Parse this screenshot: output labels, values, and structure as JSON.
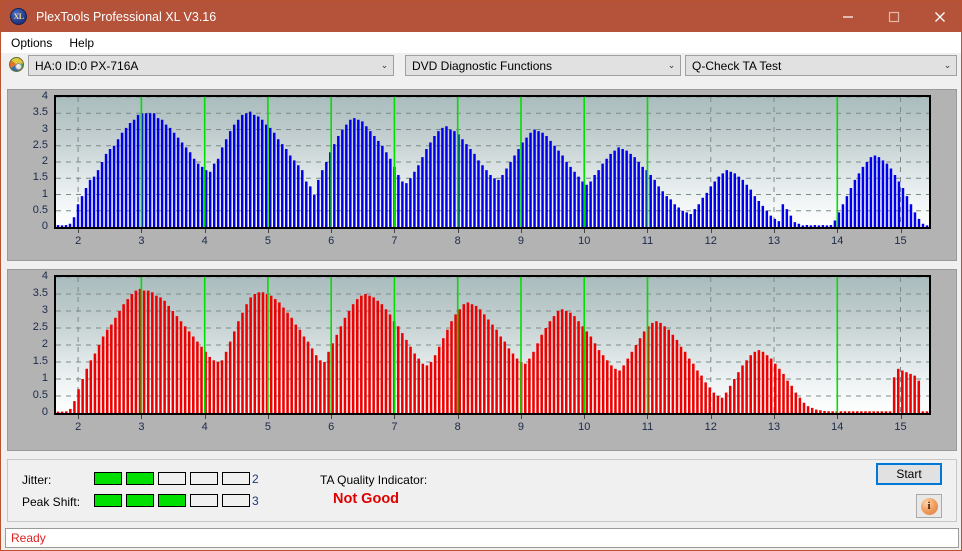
{
  "window": {
    "title": "PlexTools Professional XL V3.16",
    "app_icon": "xl-logo-icon",
    "minimize": "minimize-icon",
    "maximize": "maximize-icon",
    "close": "close-icon"
  },
  "menu": {
    "items": [
      {
        "label": "Options"
      },
      {
        "label": "Help"
      }
    ]
  },
  "toolbar": {
    "drive_icon": "disc-icon",
    "drive_combo": "HA:0 ID:0  PX-716A",
    "function_combo": "DVD Diagnostic Functions",
    "test_combo": "Q-Check TA Test",
    "arrow": "⌄"
  },
  "results": {
    "jitter_label": "Jitter:",
    "jitter_value": "2",
    "jitter_segments": 5,
    "jitter_filled": 2,
    "peak_shift_label": "Peak Shift:",
    "peak_shift_value": "3",
    "peak_shift_segments": 5,
    "peak_shift_filled": 3,
    "tqi_label": "TA Quality Indicator:",
    "tqi_value": "Not Good",
    "tqi_color": "#e00000",
    "start_label": "Start",
    "info_icon": "info-icon",
    "info_glyph": "i"
  },
  "statusbar": {
    "text": "Ready"
  },
  "chart_data": [
    {
      "id": "ta-jitter-chart",
      "type": "bar",
      "title": "",
      "xlabel": "",
      "ylabel": "",
      "series_color": "#0000ee",
      "marker_color": "#00e000",
      "xlim": [
        1.65,
        15.45
      ],
      "ylim": [
        0,
        4
      ],
      "yticks": [
        0,
        0.5,
        1,
        1.5,
        2,
        2.5,
        3,
        3.5,
        4
      ],
      "ytick_labels": [
        "0",
        "0.5",
        "1",
        "1.5",
        "2",
        "2.5",
        "3",
        "3.5",
        "4"
      ],
      "xticks": [
        2,
        3,
        4,
        5,
        6,
        7,
        8,
        9,
        10,
        11,
        12,
        13,
        14,
        15
      ],
      "xtick_labels": [
        "2",
        "3",
        "4",
        "5",
        "6",
        "7",
        "8",
        "9",
        "10",
        "11",
        "12",
        "13",
        "14",
        "15"
      ],
      "grid": true,
      "markers": [
        3,
        4,
        5,
        6,
        7,
        8,
        9,
        10,
        11,
        14
      ],
      "x": [
        1.86,
        1.92,
        1.98,
        2.04,
        2.1,
        2.16,
        2.22,
        2.28,
        2.34,
        2.4,
        2.46,
        2.52,
        2.58,
        2.64,
        2.7,
        2.76,
        2.82,
        2.88,
        2.94,
        3.0,
        3.06,
        3.12,
        3.18,
        3.24,
        3.3,
        3.36,
        3.42,
        3.48,
        3.54,
        3.6,
        3.66,
        3.72,
        3.78,
        3.84,
        3.9,
        3.96,
        4.02,
        4.08,
        4.14,
        4.2,
        4.26,
        4.32,
        4.38,
        4.44,
        4.5,
        4.56,
        4.62,
        4.68,
        4.74,
        4.8,
        4.86,
        4.92,
        4.98,
        5.04,
        5.1,
        5.16,
        5.22,
        5.28,
        5.34,
        5.4,
        5.46,
        5.52,
        5.58,
        5.64,
        5.7,
        5.76,
        5.82,
        5.88,
        5.94,
        6.0,
        6.06,
        6.12,
        6.18,
        6.24,
        6.3,
        6.36,
        6.42,
        6.48,
        6.54,
        6.6,
        6.66,
        6.72,
        6.78,
        6.84,
        6.9,
        6.96,
        7.02,
        7.08,
        7.14,
        7.2,
        7.26,
        7.32,
        7.38,
        7.44,
        7.5,
        7.56,
        7.62,
        7.68,
        7.74,
        7.8,
        7.86,
        7.92,
        7.98,
        8.04,
        8.1,
        8.16,
        8.22,
        8.28,
        8.34,
        8.4,
        8.46,
        8.52,
        8.58,
        8.64,
        8.7,
        8.76,
        8.82,
        8.88,
        8.94,
        9.0,
        9.06,
        9.12,
        9.18,
        9.24,
        9.3,
        9.36,
        9.42,
        9.48,
        9.54,
        9.6,
        9.66,
        9.72,
        9.78,
        9.84,
        9.9,
        9.96,
        10.02,
        10.08,
        10.14,
        10.2,
        10.26,
        10.32,
        10.38,
        10.44,
        10.5,
        10.56,
        10.62,
        10.68,
        10.74,
        10.8,
        10.86,
        10.92,
        10.98,
        11.04,
        11.1,
        11.16,
        11.22,
        11.28,
        11.34,
        11.4,
        11.46,
        13.56,
        13.62,
        13.68,
        13.74,
        13.8,
        13.86,
        13.92,
        13.98,
        14.04,
        14.1,
        14.16,
        14.22,
        14.28
      ],
      "values": [
        0.06,
        0.05,
        0.06,
        0.1,
        0.3,
        0.7,
        0.95,
        1.2,
        1.45,
        1.55,
        1.75,
        2.0,
        2.25,
        2.4,
        2.5,
        2.7,
        2.9,
        3.05,
        3.2,
        3.3,
        3.45,
        3.5,
        3.5,
        3.5,
        3.5,
        3.35,
        3.3,
        3.15,
        3.05,
        2.9,
        2.75,
        2.6,
        2.45,
        2.3,
        2.1,
        1.95,
        1.85,
        1.75,
        1.7,
        1.95,
        2.1,
        2.45,
        2.7,
        2.95,
        3.15,
        3.3,
        3.45,
        3.5,
        3.55,
        3.45,
        3.4,
        3.3,
        3.15,
        3.05,
        2.9,
        2.7,
        2.55,
        2.4,
        2.2,
        2.05,
        1.9,
        1.75,
        1.4,
        1.25,
        1.0,
        1.45,
        1.75,
        2.0,
        2.3,
        2.55,
        2.8,
        3.0,
        3.15,
        3.3,
        3.35,
        3.3,
        3.25,
        3.1,
        2.95,
        2.8,
        2.65,
        2.5,
        2.3,
        2.1,
        1.85,
        1.6,
        1.4,
        1.35,
        1.5,
        1.7,
        1.9,
        2.15,
        2.4,
        2.6,
        2.8,
        2.95,
        3.05,
        3.1,
        3.0,
        2.95,
        2.85,
        2.7,
        2.55,
        2.4,
        2.25,
        2.05,
        1.9,
        1.75,
        1.6,
        1.5,
        1.45,
        1.6,
        1.8,
        2.0,
        2.2,
        2.4,
        2.6,
        2.75,
        2.9,
        3.0,
        2.95,
        2.9,
        2.8,
        2.65,
        2.5,
        2.35,
        2.2,
        2.0,
        1.85,
        1.7,
        1.55,
        1.4,
        1.3,
        1.4,
        1.6,
        1.75,
        1.95,
        2.1,
        2.25,
        2.35,
        2.45,
        2.4,
        2.35,
        2.25,
        2.15,
        2.0,
        1.85,
        1.75,
        1.6,
        1.45,
        1.25,
        1.1,
        0.95,
        0.85,
        0.7,
        0.6,
        0.5,
        0.45,
        0.4,
        0.55,
        0.7,
        0.9,
        1.05,
        1.25,
        1.4,
        1.55,
        1.65,
        1.75,
        1.7,
        1.65,
        1.55,
        1.45,
        1.3,
        1.15,
        0.95,
        0.8,
        0.65,
        0.5,
        0.35,
        0.25,
        0.18,
        0.7,
        0.55,
        0.35,
        0.15,
        0.1,
        0.05,
        0.06,
        0.05,
        0.06,
        0.05,
        0.06,
        0.05,
        0.06,
        0.2,
        0.45,
        0.7,
        0.95,
        1.2,
        1.45,
        1.65,
        1.85,
        2.0,
        2.15,
        2.2,
        2.15,
        2.05,
        1.95,
        1.8,
        1.6,
        1.4,
        1.2,
        0.95,
        0.7,
        0.45,
        0.25,
        0.1,
        0.05
      ]
    },
    {
      "id": "ta-peak-shift-chart",
      "type": "bar",
      "title": "",
      "xlabel": "",
      "ylabel": "",
      "series_color": "#ee0000",
      "marker_color": "#00e000",
      "xlim": [
        1.65,
        15.45
      ],
      "ylim": [
        0,
        4
      ],
      "yticks": [
        0,
        0.5,
        1,
        1.5,
        2,
        2.5,
        3,
        3.5,
        4
      ],
      "ytick_labels": [
        "0",
        "0.5",
        "1",
        "1.5",
        "2",
        "2.5",
        "3",
        "3.5",
        "4"
      ],
      "xticks": [
        2,
        3,
        4,
        5,
        6,
        7,
        8,
        9,
        10,
        11,
        12,
        13,
        14,
        15
      ],
      "xtick_labels": [
        "2",
        "3",
        "4",
        "5",
        "6",
        "7",
        "8",
        "9",
        "10",
        "11",
        "12",
        "13",
        "14",
        "15"
      ],
      "grid": true,
      "markers": [
        3,
        4,
        5,
        6,
        7,
        8,
        9,
        10,
        11,
        14
      ],
      "values": [
        0.04,
        0.04,
        0.05,
        0.12,
        0.35,
        0.7,
        1.0,
        1.3,
        1.55,
        1.75,
        2.0,
        2.25,
        2.45,
        2.6,
        2.8,
        3.0,
        3.2,
        3.35,
        3.5,
        3.6,
        3.65,
        3.6,
        3.6,
        3.55,
        3.45,
        3.4,
        3.3,
        3.15,
        3.0,
        2.85,
        2.7,
        2.55,
        2.4,
        2.25,
        2.1,
        1.95,
        1.8,
        1.65,
        1.55,
        1.5,
        1.55,
        1.8,
        2.1,
        2.4,
        2.7,
        2.95,
        3.2,
        3.4,
        3.5,
        3.55,
        3.55,
        3.5,
        3.45,
        3.35,
        3.25,
        3.1,
        2.95,
        2.8,
        2.6,
        2.45,
        2.25,
        2.1,
        1.9,
        1.7,
        1.55,
        1.5,
        1.8,
        2.05,
        2.3,
        2.55,
        2.8,
        3.0,
        3.2,
        3.35,
        3.45,
        3.5,
        3.45,
        3.4,
        3.3,
        3.2,
        3.05,
        2.9,
        2.7,
        2.55,
        2.35,
        2.15,
        1.95,
        1.75,
        1.6,
        1.45,
        1.4,
        1.5,
        1.7,
        1.95,
        2.2,
        2.45,
        2.7,
        2.9,
        3.05,
        3.2,
        3.25,
        3.2,
        3.15,
        3.05,
        2.9,
        2.75,
        2.6,
        2.45,
        2.25,
        2.1,
        1.9,
        1.75,
        1.6,
        1.5,
        1.45,
        1.6,
        1.8,
        2.05,
        2.3,
        2.5,
        2.7,
        2.85,
        3.0,
        3.05,
        3.0,
        2.95,
        2.85,
        2.7,
        2.55,
        2.4,
        2.25,
        2.05,
        1.85,
        1.7,
        1.55,
        1.4,
        1.3,
        1.25,
        1.4,
        1.6,
        1.8,
        2.0,
        2.2,
        2.4,
        2.55,
        2.65,
        2.7,
        2.65,
        2.55,
        2.45,
        2.3,
        2.15,
        1.95,
        1.8,
        1.6,
        1.45,
        1.25,
        1.1,
        0.9,
        0.75,
        0.6,
        0.5,
        0.45,
        0.6,
        0.8,
        1.0,
        1.2,
        1.4,
        1.55,
        1.7,
        1.8,
        1.85,
        1.8,
        1.7,
        1.6,
        1.45,
        1.3,
        1.15,
        0.95,
        0.8,
        0.6,
        0.45,
        0.3,
        0.2,
        0.15,
        0.1,
        0.08,
        0.06,
        0.05,
        0.05,
        0.05,
        0.05,
        0.05,
        0.05,
        0.05,
        0.05,
        0.05,
        0.05,
        0.05,
        0.05,
        0.05,
        0.05,
        0.05,
        0.05,
        1.05,
        1.3,
        1.25,
        1.2,
        1.15,
        1.1,
        0.95,
        0.05,
        0.05
      ]
    }
  ]
}
